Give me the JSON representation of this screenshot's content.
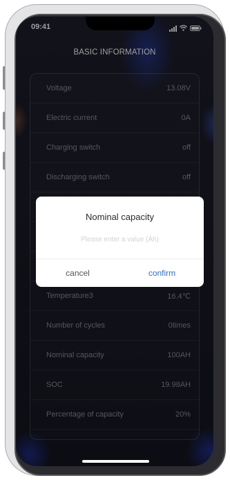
{
  "status_bar": {
    "time": "09:41"
  },
  "header": {
    "title": "BASIC INFORMATION"
  },
  "info_rows": [
    {
      "label": "Voltage",
      "value": "13.08V"
    },
    {
      "label": "Electric current",
      "value": "0A"
    },
    {
      "label": "Charging switch",
      "value": "off"
    },
    {
      "label": "Discharging switch",
      "value": "off"
    },
    {
      "label": "Temperature3",
      "value": "16.4℃"
    },
    {
      "label": "Number of cycles",
      "value": "0times"
    },
    {
      "label": "Nominal capacity",
      "value": "100AH"
    },
    {
      "label": "SOC",
      "value": "19.98AH"
    },
    {
      "label": "Percentage of capacity",
      "value": "20%"
    }
  ],
  "dialog": {
    "title": "Nominal capacity",
    "input_placeholder": "Please enter a value (Ah)",
    "input_value": "",
    "cancel_label": "cancel",
    "confirm_label": "confirm"
  },
  "colors": {
    "background": "#191a26",
    "row_text": "#8a8b96",
    "confirm_accent": "#2f6fd6",
    "dialog_bg": "#ffffff"
  }
}
